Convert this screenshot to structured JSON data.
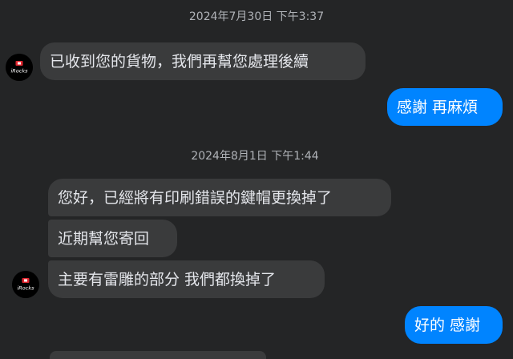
{
  "conversation": {
    "timestamp_1": "2024年7月30日 下午3:37",
    "msg_in_1": "已收到您的貨物，我們再幫您處理後續",
    "msg_out_1": "感謝 再麻煩",
    "timestamp_2": "2024年8月1日 下午1:44",
    "msg_in_2": "您好，已經將有印刷錯誤的鍵帽更換掉了",
    "msg_in_3": "近期幫您寄回",
    "msg_in_4": "主要有雷雕的部分 我們都換掉了",
    "msg_out_2": "好的 感謝"
  },
  "contact": {
    "avatar_text": "iRocks",
    "avatar_icon": "irocks-logo-icon"
  },
  "colors": {
    "background": "#242526",
    "incoming_bubble": "#3a3b3c",
    "outgoing_bubble": "#0084ff",
    "accent_red": "#e0262f"
  }
}
